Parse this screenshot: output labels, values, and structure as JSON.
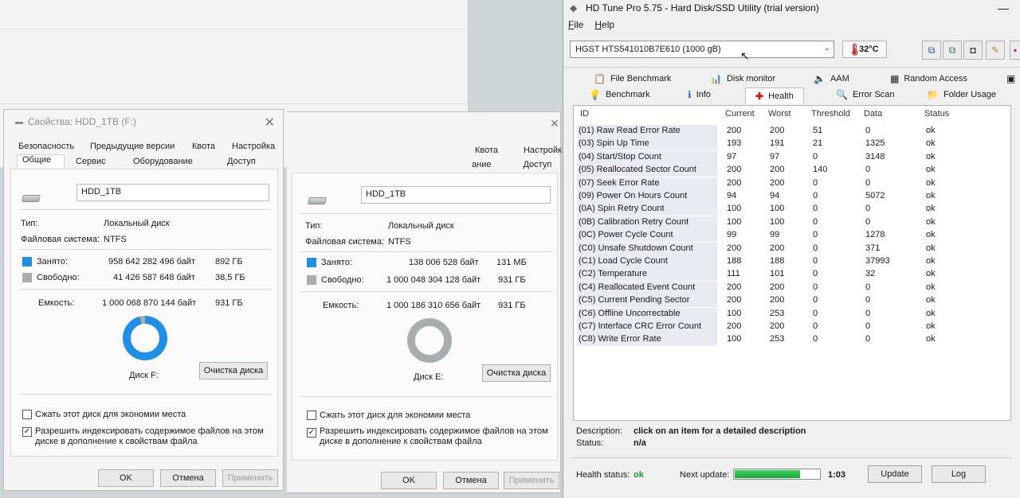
{
  "dialog_left": {
    "title": "Свойства: HDD_1TB (F:)",
    "tabs_row1": [
      "Безопасность",
      "Предыдущие версии",
      "Квота",
      "Настройка"
    ],
    "tabs_row2": [
      "Общие",
      "Сервис",
      "Оборудование",
      "Доступ"
    ],
    "name": "HDD_1TB",
    "type_label": "Тип:",
    "type_value": "Локальный диск",
    "fs_label": "Файловая система:",
    "fs_value": "NTFS",
    "used_label": "Занято:",
    "used_bytes": "958 642 282 496 байт",
    "used_size": "892 ГБ",
    "free_label": "Свободно:",
    "free_bytes": "41 426 587 648 байт",
    "free_size": "38,5 ГБ",
    "cap_label": "Емкость:",
    "cap_bytes": "1 000 068 870 144 байт",
    "cap_size": "931 ГБ",
    "used_fraction": 0.96,
    "disk_label": "Диск F:",
    "cleanup_button": "Очистка диска",
    "compress_label": "Сжать этот диск для экономии места",
    "index_label_1": "Разрешить индексировать содержимое файлов на этом",
    "index_label_2": "диске в дополнение к свойствам файла",
    "ok": "OK",
    "cancel": "Отмена",
    "apply": "Применить",
    "used_color": "#1e90e8",
    "free_color": "#a8adb0"
  },
  "dialog_right": {
    "tabs_row1": [
      "Квота",
      "Настройка"
    ],
    "tabs_row2": [
      "ание",
      "Доступ"
    ],
    "name": "HDD_1TB",
    "type_label": "Тип:",
    "type_value": "Локальный диск",
    "fs_label": "Файловая система:",
    "fs_value": "NTFS",
    "used_label": "Занято:",
    "used_bytes": "138 006 528 байт",
    "used_size": "131 МБ",
    "free_label": "Свободно:",
    "free_bytes": "1 000 048 304 128 байт",
    "free_size": "931 ГБ",
    "cap_label": "Емкость:",
    "cap_bytes": "1 000 186 310 656 байт",
    "cap_size": "931 ГБ",
    "used_fraction": 0.0,
    "disk_label": "Диск E:",
    "cleanup_button": "Очистка диска",
    "compress_label": "Сжать этот диск для экономии места",
    "index_label_1": "Разрешить индексировать содержимое файлов на этом",
    "index_label_2": "диске в дополнение к свойствам файла",
    "ok": "OK",
    "cancel": "Отмена",
    "apply": "Применить"
  },
  "hdtune": {
    "title": "HD Tune Pro 5.75 - Hard Disk/SSD Utility (trial version)",
    "menu": [
      "File",
      "Help"
    ],
    "drive": "HGST HTS541010B7E610 (1000 gB)",
    "temperature": "32°C",
    "tabs_row1": [
      "File Benchmark",
      "Disk monitor",
      "AAM",
      "Random Access"
    ],
    "tabs_row2": [
      "Benchmark",
      "Info",
      "Health",
      "Error Scan",
      "Folder Usage"
    ],
    "columns": [
      "ID",
      "Current",
      "Worst",
      "Threshold",
      "Data",
      "Status"
    ],
    "rows": [
      [
        "(01) Raw Read Error Rate",
        "200",
        "200",
        "51",
        "0",
        "ok"
      ],
      [
        "(03) Spin Up Time",
        "193",
        "191",
        "21",
        "1325",
        "ok"
      ],
      [
        "(04) Start/Stop Count",
        "97",
        "97",
        "0",
        "3148",
        "ok"
      ],
      [
        "(05) Reallocated Sector Count",
        "200",
        "200",
        "140",
        "0",
        "ok"
      ],
      [
        "(07) Seek Error Rate",
        "200",
        "200",
        "0",
        "0",
        "ok"
      ],
      [
        "(09) Power On Hours Count",
        "94",
        "94",
        "0",
        "5072",
        "ok"
      ],
      [
        "(0A) Spin Retry Count",
        "100",
        "100",
        "0",
        "0",
        "ok"
      ],
      [
        "(0B) Calibration Retry Count",
        "100",
        "100",
        "0",
        "0",
        "ok"
      ],
      [
        "(0C) Power Cycle Count",
        "99",
        "99",
        "0",
        "1278",
        "ok"
      ],
      [
        "(C0) Unsafe Shutdown Count",
        "200",
        "200",
        "0",
        "371",
        "ok"
      ],
      [
        "(C1) Load Cycle Count",
        "188",
        "188",
        "0",
        "37993",
        "ok"
      ],
      [
        "(C2) Temperature",
        "111",
        "101",
        "0",
        "32",
        "ok"
      ],
      [
        "(C4) Reallocated Event Count",
        "200",
        "200",
        "0",
        "0",
        "ok"
      ],
      [
        "(C5) Current Pending Sector",
        "200",
        "200",
        "0",
        "0",
        "ok"
      ],
      [
        "(C6) Offline Uncorrectable",
        "100",
        "253",
        "0",
        "0",
        "ok"
      ],
      [
        "(C7) Interface CRC Error Count",
        "200",
        "200",
        "0",
        "0",
        "ok"
      ],
      [
        "(C8) Write Error Rate",
        "100",
        "253",
        "0",
        "0",
        "ok"
      ]
    ],
    "description_label": "Description:",
    "description_value": "click on an item for a detailed description",
    "status_label": "Status:",
    "status_value": "n/a",
    "health_label": "Health status:",
    "health_value": "ok",
    "next_update_label": "Next update:",
    "next_update_progress": 0.77,
    "next_update_time": "1:03",
    "update_button": "Update",
    "log_button": "Log",
    "ok_color": "#1a9a2a"
  }
}
